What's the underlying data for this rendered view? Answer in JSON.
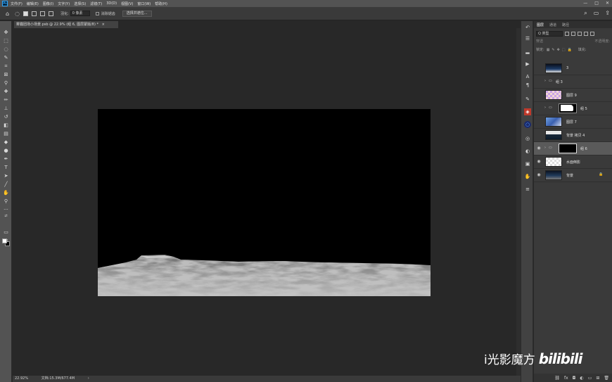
{
  "app": {
    "logo_text": "Ps"
  },
  "menu": [
    "文件(F)",
    "编辑(E)",
    "图像(I)",
    "文字(Y)",
    "选择(S)",
    "滤镜(T)",
    "3D(D)",
    "视图(V)",
    "窗口(W)",
    "帮助(H)"
  ],
  "window_controls": {
    "minimize": "—",
    "maximize": "□",
    "close": "✕"
  },
  "options": {
    "feather_label": "羽化:",
    "feather_value": "0 像素",
    "antialias_label": "消除锯齿",
    "select_mask_button": "选择并遮住..."
  },
  "document": {
    "tab_title": "雾霾团场小场景.psb @ 22.9% (组 6, 图层蒙版/8) *",
    "close": "×"
  },
  "status": {
    "zoom": "22.92%",
    "doc_size": "文档:15.3M/677.4M",
    "arrow": "›"
  },
  "layers_panel": {
    "tabs": [
      "图层",
      "通道",
      "路径"
    ],
    "kind_filter": "Q 类型",
    "mode": "穿透",
    "opacity_label": "不透明度:",
    "lock_label": "锁定:",
    "fill_label": "填充:",
    "layers": [
      {
        "name": "3",
        "type": "image",
        "thumb": "dark-city"
      },
      {
        "name": "组 3",
        "type": "group"
      },
      {
        "name": "图层 9",
        "type": "image",
        "thumb": "red-check"
      },
      {
        "name": "组 5",
        "type": "group-mask"
      },
      {
        "name": "图层 7",
        "type": "image",
        "thumb": "blue"
      },
      {
        "name": "背景 拷贝 4",
        "type": "image",
        "thumb": "dark-city"
      },
      {
        "name": "组 6",
        "type": "group-mask",
        "selected": true
      },
      {
        "name": "水面倒影",
        "type": "image",
        "thumb": "checker-light"
      },
      {
        "name": "背景",
        "type": "image",
        "thumb": "dark-city",
        "locked": true
      }
    ],
    "bottom_icons": [
      "link-icon",
      "fx-icon",
      "mask-icon",
      "adjustment-icon",
      "folder-icon",
      "new-layer-icon",
      "trash-icon"
    ]
  },
  "watermark": {
    "text": "i光影魔方",
    "logo": "bilibili"
  }
}
